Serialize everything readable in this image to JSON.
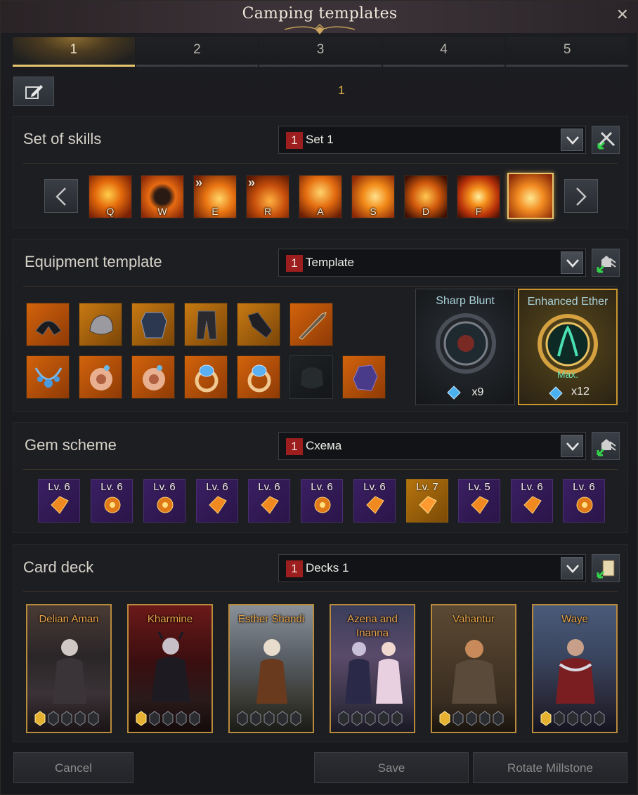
{
  "window": {
    "title": "Camping templates",
    "close_icon": "close-icon"
  },
  "tabs": [
    {
      "label": "1",
      "active": true
    },
    {
      "label": "2",
      "active": false
    },
    {
      "label": "3",
      "active": false
    },
    {
      "label": "4",
      "active": false
    },
    {
      "label": "5",
      "active": false
    }
  ],
  "template_name": "1",
  "skills": {
    "title": "Set of skills",
    "dropdown_number": "1",
    "dropdown_value": "Set 1",
    "keys": [
      "Q",
      "W",
      "E",
      "R",
      "A",
      "S",
      "D",
      "F",
      ""
    ]
  },
  "equipment": {
    "title": "Equipment template",
    "dropdown_number": "1",
    "dropdown_value": "Template",
    "engravings": [
      {
        "name": "Sharp Blunt",
        "count": "x9",
        "max": ""
      },
      {
        "name": "Enhanced Ether",
        "count": "x12",
        "max": "Max."
      }
    ]
  },
  "gems": {
    "title": "Gem scheme",
    "dropdown_number": "1",
    "dropdown_value": "Схема",
    "levels": [
      "Lv. 6",
      "Lv. 6",
      "Lv. 6",
      "Lv. 6",
      "Lv. 6",
      "Lv. 6",
      "Lv. 6",
      "Lv. 7",
      "Lv. 5",
      "Lv. 6",
      "Lv. 6"
    ],
    "highlighted_index": 7
  },
  "cards": {
    "title": "Card deck",
    "dropdown_number": "1",
    "dropdown_value": "Decks 1",
    "items": [
      {
        "name": "Delian Aman",
        "awaken": 1
      },
      {
        "name": "Kharmine",
        "awaken": 1
      },
      {
        "name": "Esther Shandi",
        "awaken": 0
      },
      {
        "name": "Azena and Inanna",
        "awaken": 0
      },
      {
        "name": "Vahantur",
        "awaken": 1
      },
      {
        "name": "Waye",
        "awaken": 1
      }
    ]
  },
  "footer": {
    "cancel": "Cancel",
    "save": "Save",
    "rotate": "Rotate Millstone"
  },
  "colors": {
    "accent_gold": "#e7c46e",
    "number_badge": "#9c1e1e",
    "gem_purple": "#3a1f63",
    "card_name": "#e8a449"
  }
}
